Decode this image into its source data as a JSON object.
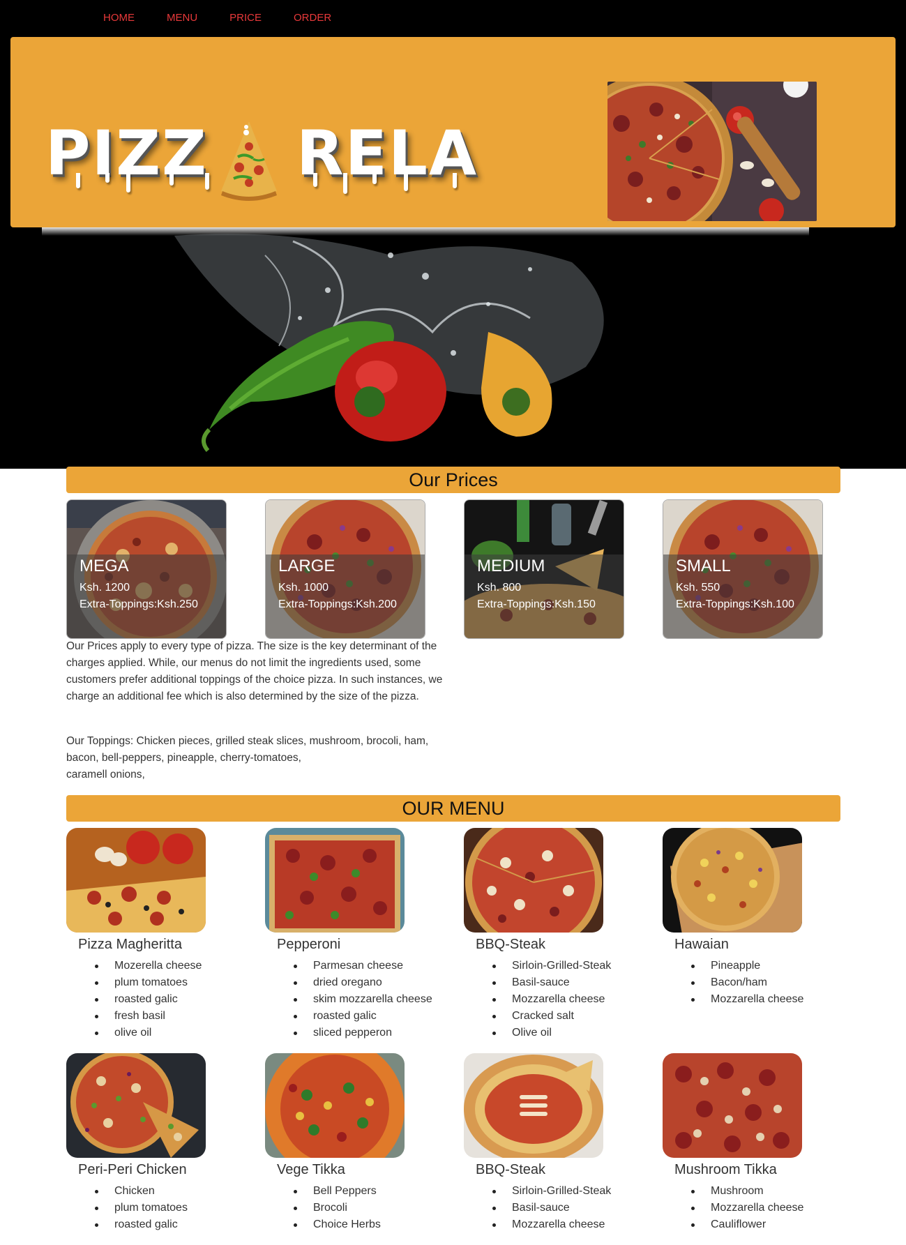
{
  "nav": {
    "items": [
      {
        "label": "HOME"
      },
      {
        "label": "MENU"
      },
      {
        "label": "PRICE"
      },
      {
        "label": "ORDER"
      }
    ]
  },
  "header": {
    "logo_left": "PIZZ",
    "logo_right": "RELA",
    "accent_color": "#eba538",
    "nav_color": "#e8393a"
  },
  "prices": {
    "heading": "Our Prices",
    "cards": [
      {
        "name": "MEGA",
        "price": "Ksh. 1200",
        "extra": "Extra-Toppings:Ksh.250"
      },
      {
        "name": "LARGE",
        "price": "Ksh. 1000",
        "extra": "Extra-Toppings:Ksh.200"
      },
      {
        "name": "MEDIUM",
        "price": "Ksh. 800",
        "extra": "Extra-Toppings:Ksh.150"
      },
      {
        "name": "SMALL",
        "price": "Ksh. 550",
        "extra": "Extra-Toppings:Ksh.100"
      }
    ],
    "description": "Our Prices apply to every type of pizza. The size is the key determinant of the charges applied. While, our menus do not limit the ingredients used, some customers prefer additional toppings of the choice pizza. In such instances, we charge an additional fee which is also determined by the size of the pizza.",
    "toppings_line1": "Our Toppings: Chicken pieces, grilled steak slices, mushroom, brocoli, ham, bacon, bell-peppers, pineapple, cherry-tomatoes,",
    "toppings_line2": "caramell onions,"
  },
  "menu": {
    "heading": "OUR MENU",
    "items": [
      {
        "title": "Pizza Magheritta",
        "ingredients": [
          "Mozerella cheese",
          "plum tomatoes",
          "roasted galic",
          "fresh basil",
          "olive oil"
        ]
      },
      {
        "title": "Pepperoni",
        "ingredients": [
          "Parmesan cheese",
          "dried oregano",
          "skim mozzarella cheese",
          "roasted galic",
          "sliced pepperon"
        ]
      },
      {
        "title": "BBQ-Steak",
        "ingredients": [
          "Sirloin-Grilled-Steak",
          "Basil-sauce",
          "Mozzarella cheese",
          "Cracked salt",
          "Olive oil"
        ]
      },
      {
        "title": "Hawaian",
        "ingredients": [
          "Pineapple",
          "Bacon/ham",
          "Mozzarella cheese"
        ]
      },
      {
        "title": "Peri-Peri Chicken",
        "ingredients": [
          "Chicken",
          "plum tomatoes",
          "roasted galic"
        ]
      },
      {
        "title": "Vege Tikka",
        "ingredients": [
          "Bell Peppers",
          "Brocoli",
          "Choice Herbs"
        ]
      },
      {
        "title": "BBQ-Steak",
        "ingredients": [
          "Sirloin-Grilled-Steak",
          "Basil-sauce",
          "Mozzarella cheese"
        ]
      },
      {
        "title": "Mushroom Tikka",
        "ingredients": [
          "Mushroom",
          "Mozzarella cheese",
          "Cauliflower"
        ]
      }
    ]
  }
}
